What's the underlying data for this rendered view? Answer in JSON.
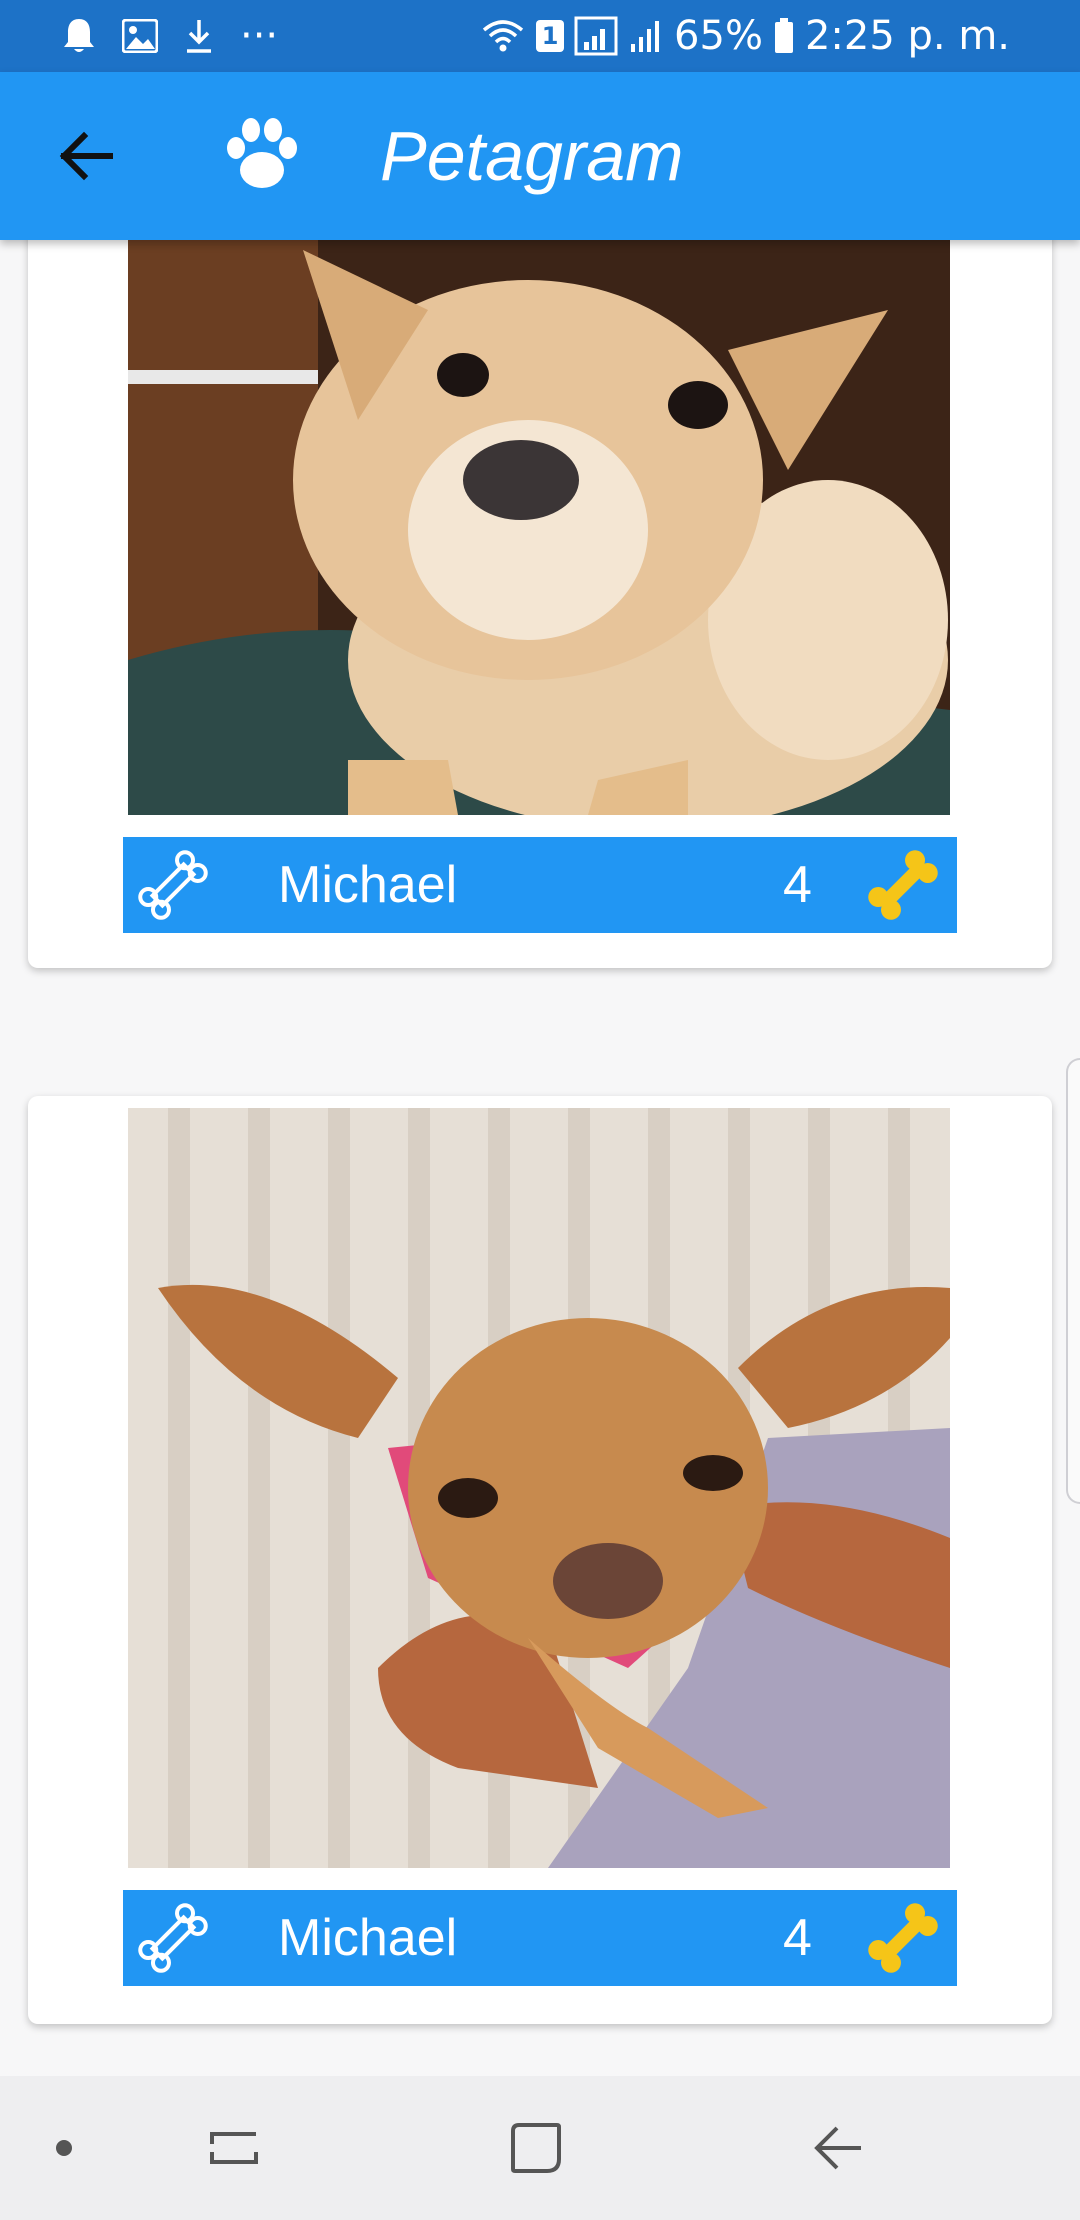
{
  "status_bar": {
    "battery": "65%",
    "time": "2:25 p. m.",
    "sim": "1",
    "more": "···"
  },
  "app_bar": {
    "title": "Petagram"
  },
  "pets": [
    {
      "name": "Michael",
      "likes": "4"
    },
    {
      "name": "Michael",
      "likes": "4"
    }
  ],
  "colors": {
    "status_bar": "#1d72c7",
    "primary": "#2196f3",
    "bone_gold": "#f5c518"
  },
  "icons": {
    "back": "arrow-left-icon",
    "logo": "paw-icon",
    "like": "bone-outline-icon",
    "rating": "bone-filled-icon"
  }
}
